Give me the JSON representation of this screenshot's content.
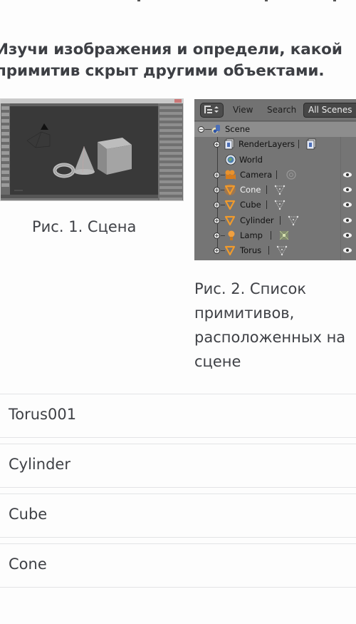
{
  "question": {
    "line1": "Изучи изображения и определи, какой",
    "line2": "примитив скрыт другими объектами."
  },
  "figure1": {
    "caption": "Рис. 1. Сцена",
    "scene_objects": [
      "camera",
      "torus",
      "cone",
      "cube"
    ]
  },
  "figure2": {
    "caption_lines": [
      "Рис. 2. Список",
      "примитивов,",
      "расположенных на",
      "сцене"
    ],
    "header": {
      "display_mode_icon": "outliner-display-icon",
      "menu_view": "View",
      "menu_search": "Search",
      "scene_filter": "All Scenes"
    },
    "tree": [
      {
        "label": "Scene",
        "icon": "scene-icon",
        "expander": "−",
        "level": 0,
        "selected": true
      },
      {
        "label": "RenderLayers",
        "icon": "render-layers-icon",
        "expander": "+",
        "level": 1,
        "data_icon": "render-layer-data-icon"
      },
      {
        "label": "World",
        "icon": "world-icon",
        "expander": "",
        "level": 1
      },
      {
        "label": "Camera",
        "icon": "camera-object-icon",
        "expander": "+",
        "level": 1,
        "data_icon": "camera-data-icon",
        "visible": true
      },
      {
        "label": "Cone",
        "icon": "mesh-object-icon",
        "expander": "+",
        "level": 1,
        "data_icon": "mesh-data-icon",
        "visible": true,
        "active": true
      },
      {
        "label": "Cube",
        "icon": "mesh-object-icon",
        "expander": "+",
        "level": 1,
        "data_icon": "mesh-data-icon",
        "visible": true
      },
      {
        "label": "Cylinder",
        "icon": "mesh-object-icon",
        "expander": "+",
        "level": 1,
        "data_icon": "mesh-data-icon",
        "visible": true
      },
      {
        "label": "Lamp",
        "icon": "lamp-object-icon",
        "expander": "+",
        "level": 1,
        "data_icon": "lamp-data-icon",
        "visible": true
      },
      {
        "label": "Torus",
        "icon": "mesh-object-icon",
        "expander": "+",
        "level": 1,
        "data_icon": "mesh-data-icon",
        "visible": true
      }
    ]
  },
  "answers": [
    {
      "label": "Torus001"
    },
    {
      "label": "Cylinder"
    },
    {
      "label": "Cube"
    },
    {
      "label": "Cone"
    }
  ],
  "colors": {
    "text": "#3f4146",
    "divider": "#e3e4e6",
    "outliner_bg": "#757575",
    "object_orange": "#e8922e"
  }
}
